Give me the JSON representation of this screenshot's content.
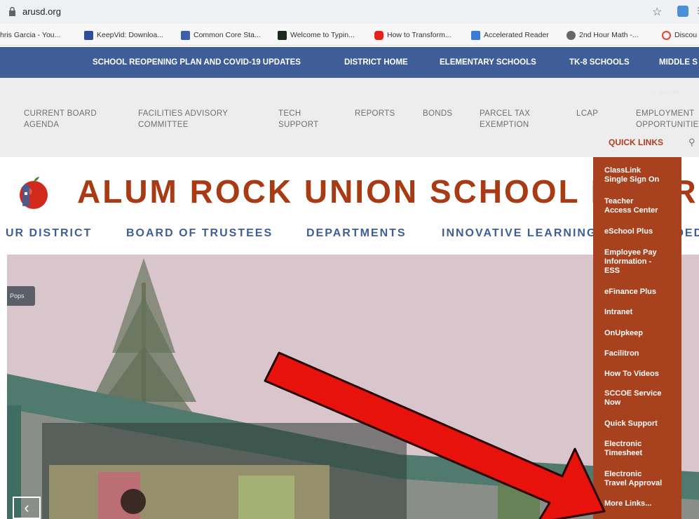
{
  "browser": {
    "url": "arusd.org",
    "bookmarks": [
      "hris Garcia - You...",
      "KeepVid: Downloa...",
      "Common Core Sta...",
      "Welcome to Typin...",
      "How to Transform...",
      "Accelerated Reader",
      "2nd Hour Math -...",
      "Discou"
    ]
  },
  "top_nav": [
    "SCHOOL REOPENING PLAN AND COVID-19 UPDATES",
    "DISTRICT HOME",
    "ELEMENTARY SCHOOLS",
    "TK-8 SCHOOLS",
    "MIDDLE S"
  ],
  "secondary_nav": {
    "items": [
      "CURRENT BOARD\nAGENDA",
      "FACILITIES ADVISORY\nCOMMITTEE",
      "TECH\nSUPPORT",
      "REPORTS",
      "BONDS",
      "PARCEL TAX\nEXEMPTION",
      "LCAP",
      "EMPLOYMENT\nOPPORTUNITIE"
    ],
    "quick_links_label": "QUICK LINKS"
  },
  "site": {
    "title": "ALUM ROCK UNION SCHOOL DISTRI",
    "main_nav": [
      "UR DISTRICT",
      "BOARD OF TRUSTEES",
      "DEPARTMENTS",
      "INNOVATIVE LEARNING",
      "EXTENDED"
    ]
  },
  "hero": {
    "pill_text": "Pops",
    "prev_symbol": "‹"
  },
  "quick_links": [
    "ClassLink\nSingle Sign On",
    "Teacher\nAccess Center",
    "eSchool Plus",
    "Employee Pay\nInformation -\nESS",
    "eFinance Plus",
    "Intranet",
    "OnUpkeep",
    "Facilitron",
    "How To Videos",
    "SCCOE Service\nNow",
    "Quick Support",
    "Electronic\nTimesheet",
    "Electronic\nTravel Approval",
    "More Links..."
  ],
  "colors": {
    "navy": "#3f5e97",
    "brand": "#a83a14",
    "dropdown": "#a8411e",
    "arrow": "#e8120c"
  }
}
